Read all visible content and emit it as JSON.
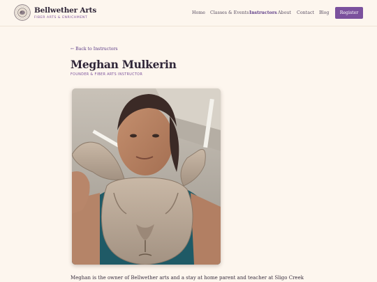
{
  "brand": {
    "name": "Bellwether Arts",
    "tagline": "FIBER ARTS & ENRICHMENT",
    "logo_icon": "bellwether-seal-icon"
  },
  "nav": {
    "items": [
      {
        "label": "Home",
        "active": false
      },
      {
        "label": "Classes & Events",
        "active": false
      },
      {
        "label": "Instructors",
        "active": true
      },
      {
        "label": "About",
        "active": false
      },
      {
        "label": "Contact",
        "active": false
      },
      {
        "label": "Blog",
        "active": false
      }
    ],
    "register_label": "Register"
  },
  "profile": {
    "back_link": "← Back to Instructors",
    "name": "Meghan Mulkerin",
    "role": "FOUNDER & FIBER ARTS INSTRUCTOR",
    "bio": "Meghan is the owner of Bellwether arts and a stay at home parent and teacher at Sligo Creek"
  },
  "colors": {
    "background": "#fdf6ee",
    "accent": "#7b519d",
    "text": "#2f2638"
  }
}
